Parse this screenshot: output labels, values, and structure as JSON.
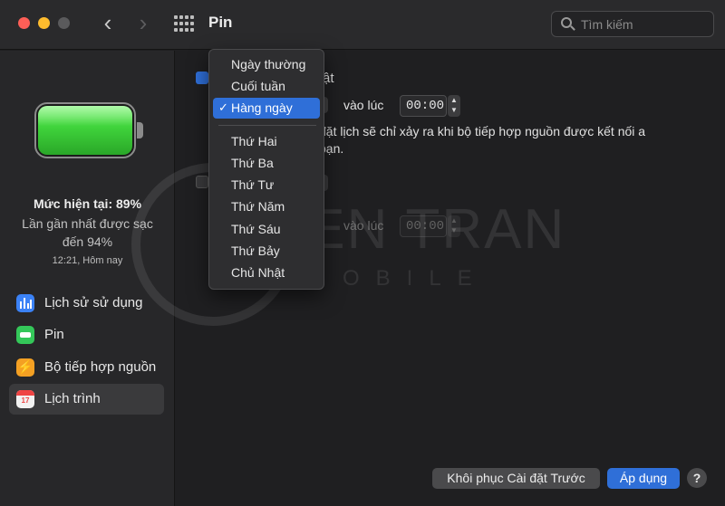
{
  "window": {
    "title": "Pin",
    "search_placeholder": "Tìm kiếm"
  },
  "sidebar": {
    "battery_level_fraction": 0.89,
    "charge_current": "Mức hiện tại: 89%",
    "charge_last": "Lần gần nhất được sạc đến 94%",
    "charge_time": "12:21, Hôm nay",
    "items": [
      {
        "label": "Lịch sử sử dụng",
        "icon": "usage-history-icon"
      },
      {
        "label": "Pin",
        "icon": "battery-icon"
      },
      {
        "label": "Bộ tiếp hợp nguồn",
        "icon": "power-adapter-icon"
      },
      {
        "label": "Lịch trình",
        "icon": "schedule-icon",
        "active": true
      }
    ]
  },
  "schedule": {
    "row1_text": "ật",
    "at_label": "vào lúc",
    "time1": "00:00",
    "time2": "00:00",
    "note": "đặt lịch sẽ chỉ xảy ra khi bộ tiếp hợp nguồn được kết nối a bạn."
  },
  "menu": {
    "items": [
      "Ngày thường",
      "Cuối tuần",
      "Hàng ngày",
      "Thứ Hai",
      "Thứ Ba",
      "Thứ Tư",
      "Thứ Năm",
      "Thứ Sáu",
      "Thứ Bảy",
      "Chủ Nhật"
    ],
    "selected": "Hàng ngày",
    "checkmark": "✓"
  },
  "watermark": {
    "main": "IEN TRAN",
    "sub": "MOBILE"
  },
  "footer": {
    "restore_label": "Khôi phục Cài đặt Trước",
    "apply_label": "Áp dụng",
    "help_label": "?"
  },
  "colors": {
    "accent": "#2f6fd8",
    "battery_green": "#3fd23b",
    "close": "#fe5f57",
    "minimize": "#febc2e"
  }
}
